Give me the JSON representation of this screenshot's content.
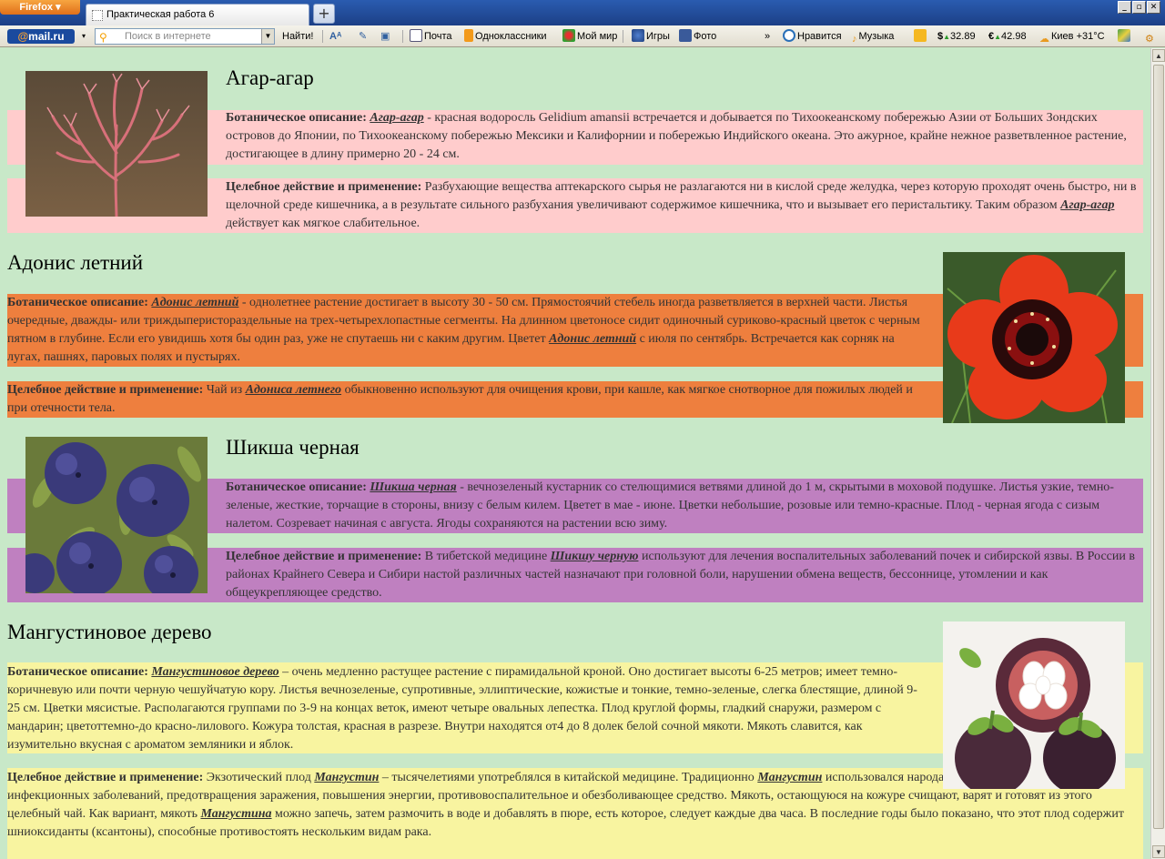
{
  "browser": {
    "menu_button": "Firefox",
    "tab_title": "Практическая работа 6",
    "new_tab": "+"
  },
  "toolbar": {
    "logo_prefix": "@",
    "logo_text": "mail.ru",
    "search_placeholder": "Поиск в интернете",
    "search_button": "Найти!",
    "links": [
      "Почта",
      "Одноклассники",
      "Мой мир",
      "Игры",
      "Фото"
    ],
    "more": "»",
    "like": "Нравится",
    "music": "Музыка",
    "usd": "32.89",
    "eur": "42.98",
    "weather": "Киев +31°C"
  },
  "sections": [
    {
      "title": "Агар-агар",
      "bot_label": "Ботаническое описание:",
      "bot_link": "Агар-агар",
      "bot_text": " - красная водоросль Gelidium amansii встречается и добывается по Тихоокеанскому побережью Азии от Больших Зондских островов до Японии, по Тихоокеанскому побережью Мексики и Калифорнии и побережью Индийского океана. Это ажурное, крайне нежное разветвленное растение, достигающее в длину примерно 20 - 24 см.",
      "heal_label": "Целебное действие и применение:",
      "heal_text1": " Разбухающие вещества аптекарского сырья не разлагаются ни в кислой среде желудка, через которую проходят очень быстро, ни в щелочной среде кишечника, а в результате сильного разбухания увеличивают содержимое кишечника, что и вызывает его перистальтику. Таким образом ",
      "heal_link": "Агар-агар",
      "heal_text2": " действует как мягкое слабительное."
    },
    {
      "title": "Адонис летний",
      "bot_label": "Ботаническое описание:",
      "bot_link": "Адонис летний",
      "bot_text1": " - однолетнее растение достигает в высоту 30 - 50 см. Прямостоячий стебель иногда разветвляется в верхней части. Листья очередные, дважды- или трижды­перистораздельные на трех-четырехлопастные сегменты. На длинном цветоносе сидит одиночный суриково-красный цветок с черным пятном в глубине. Если его увидишь хотя бы один раз, уже не спутаешь ни с каким другим. Цветет ",
      "bot_link2": "Адонис летний",
      "bot_text2": " с июля по сентябрь. Встречается как сорняк на лугах, пашнях, паровых полях и пустырях.",
      "heal_label": "Целебное действие и применение:",
      "heal_text1": " Чай из ",
      "heal_link": "Адониса летнего",
      "heal_text2": " обыкновенно используют для очищения крови, при кашле, как мягкое снотворное для пожилых людей и при отечности тела."
    },
    {
      "title": "Шикша черная",
      "bot_label": "Ботаническое описание:",
      "bot_link": "Шикша черная",
      "bot_text": " - вечнозеленый кустарник со стелющимися ветвями длиной до 1 м, скрытыми в моховой подушке. Листья узкие, темно-зеленые, жесткие, торчащие в стороны, внизу с белым килем. Цветет в мае - июне. Цветки небольшие, розовые или темно-красные. Плод - черная ягода с сизым налетом. Созревает начиная с августа. Ягоды сохраняются на растении всю зиму.",
      "heal_label": "Целебное действие и применение:",
      "heal_text1": " В тибетской медицине ",
      "heal_link": "Шикшу черную",
      "heal_text2": " используют для лечения воспалительных заболеваний почек и сибирской язвы. В России в районах Крайнего Севера и Сибири настой различных частей назначают при головной боли, нарушении обмена веществ, бессоннице, утомлении и как общеукрепляющее средство."
    },
    {
      "title": "Мангустиновое дерево",
      "bot_label": "Ботаническое описание:",
      "bot_link": "Мангустиновое дерево",
      "bot_text": " – очень медленно растущее растение с пирамидальной кроной. Оно достигает высоты 6-25 метров; имеет темно-коричневую или почти черную чешуйчатую кору. Листья вечнозеленые, супротивные, эллиптические, кожистые и тонкие, темно-зеленые, слегка блестящие, длиной 9-25 см. Цветки мясистые. Располагаются группами по 3-9 на концах веток, имеют четыре овальных лепестка. Плод круглой формы, гладкий снаружи, размером с мандарин; цветоттемно-до красно-лилового. Кожура толстая, красная в разрезе. Внутри находятся от4 до 8 долек белой сочной мякоти. Мякоть славится, как изумительно вкусная с ароматом земляники и яблок.",
      "heal_label": "Целебное действие и применение:",
      "heal_text1": " Экзотический плод ",
      "heal_link": "Мангустин",
      "heal_text2": " – тысячелетиями употреблялся в китайской медицине. Традиционно ",
      "heal_link2": "Мангустин",
      "heal_text3": " использовался народами Южной Азии для лечения инфекционных заболеваний, предотвращения заражения, повышения энергии, противовоспалительное и обезболивающее средство. Мякоть, остающуюся на кожуре счищают, варят и готовят из этого целебный чай. Как вариант, мякоть ",
      "heal_link3": "Мангустина",
      "heal_text4": " можно запечь, затем размочить в воде и добавлять в пюре, есть которое, следует каждые два часа. В последние годы было показано, что этот плод содержит шниоксиданты (ксантоны), способные противостоять нескольким видам рака."
    }
  ],
  "colors": {
    "page_bg": "#c8e8c8",
    "agar_band": "#ffcccc",
    "adonis_band": "#ee7f3e",
    "shiksha_band": "#bf80c0",
    "mangosteen_band": "#f8f4a0"
  }
}
